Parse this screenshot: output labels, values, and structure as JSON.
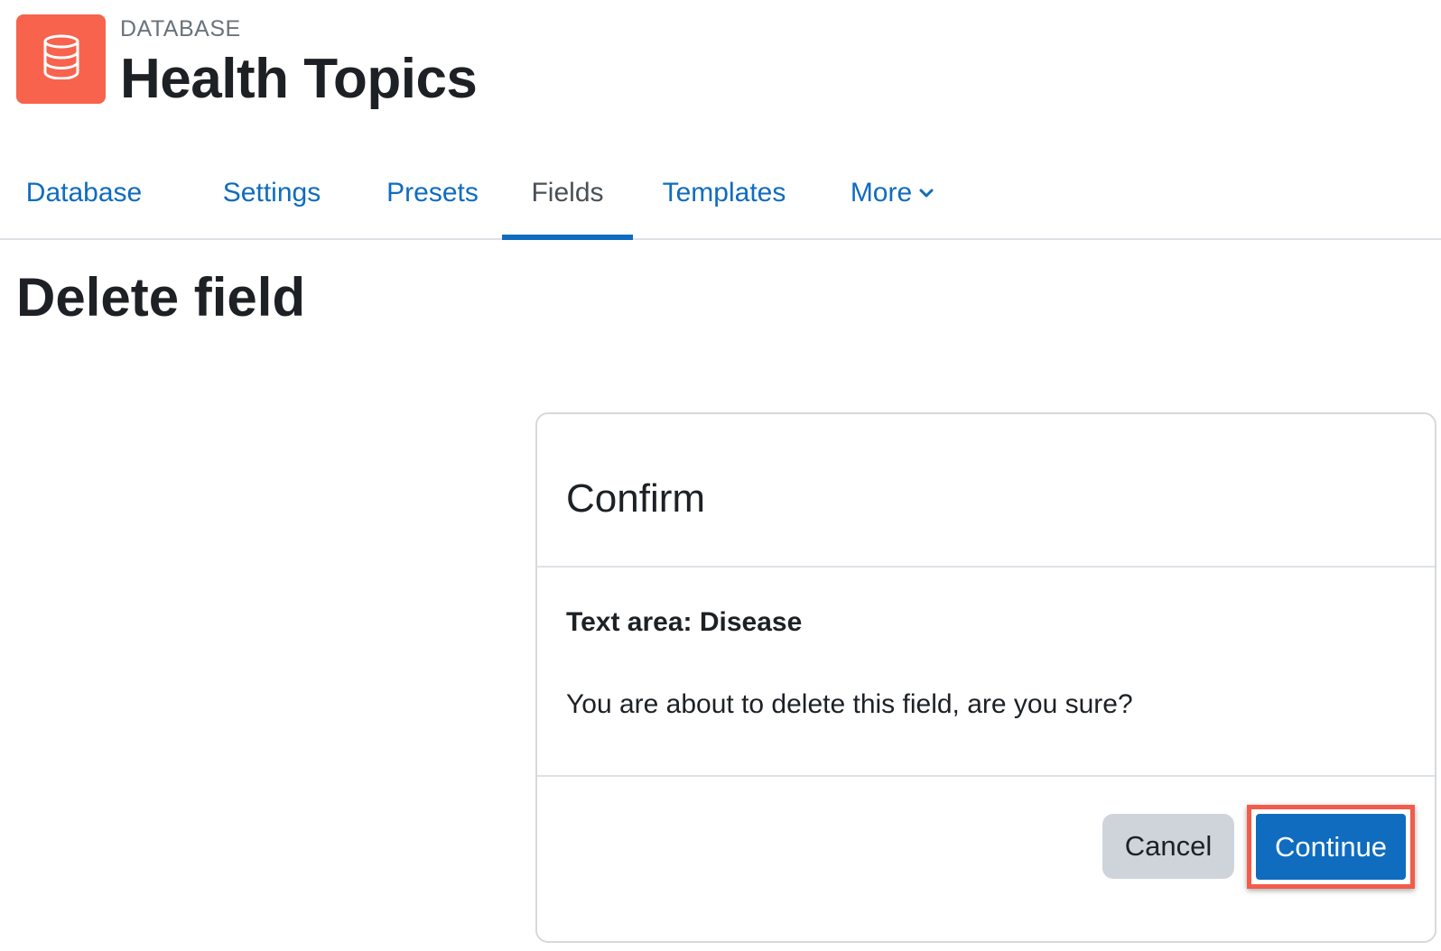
{
  "header": {
    "activity_type": "DATABASE",
    "activity_name": "Health Topics",
    "icon": "database-icon",
    "icon_bg_color": "#f7634d"
  },
  "tabs": [
    {
      "label": "Database",
      "active": false
    },
    {
      "label": "Settings",
      "active": false
    },
    {
      "label": "Presets",
      "active": false
    },
    {
      "label": "Fields",
      "active": true
    },
    {
      "label": "Templates",
      "active": false
    },
    {
      "label": "More",
      "active": false,
      "icon": "chevron-down-icon"
    }
  ],
  "page_title": "Delete field",
  "confirm": {
    "title": "Confirm",
    "field_name": "Text area: Disease",
    "message": "You are about to delete this field, are you sure?",
    "cancel_label": "Cancel",
    "continue_label": "Continue"
  },
  "colors": {
    "link": "#0f6cbf",
    "primary_button": "#0f6cbf",
    "secondary_button": "#ced4da",
    "highlight_outline": "#f25c4a"
  }
}
